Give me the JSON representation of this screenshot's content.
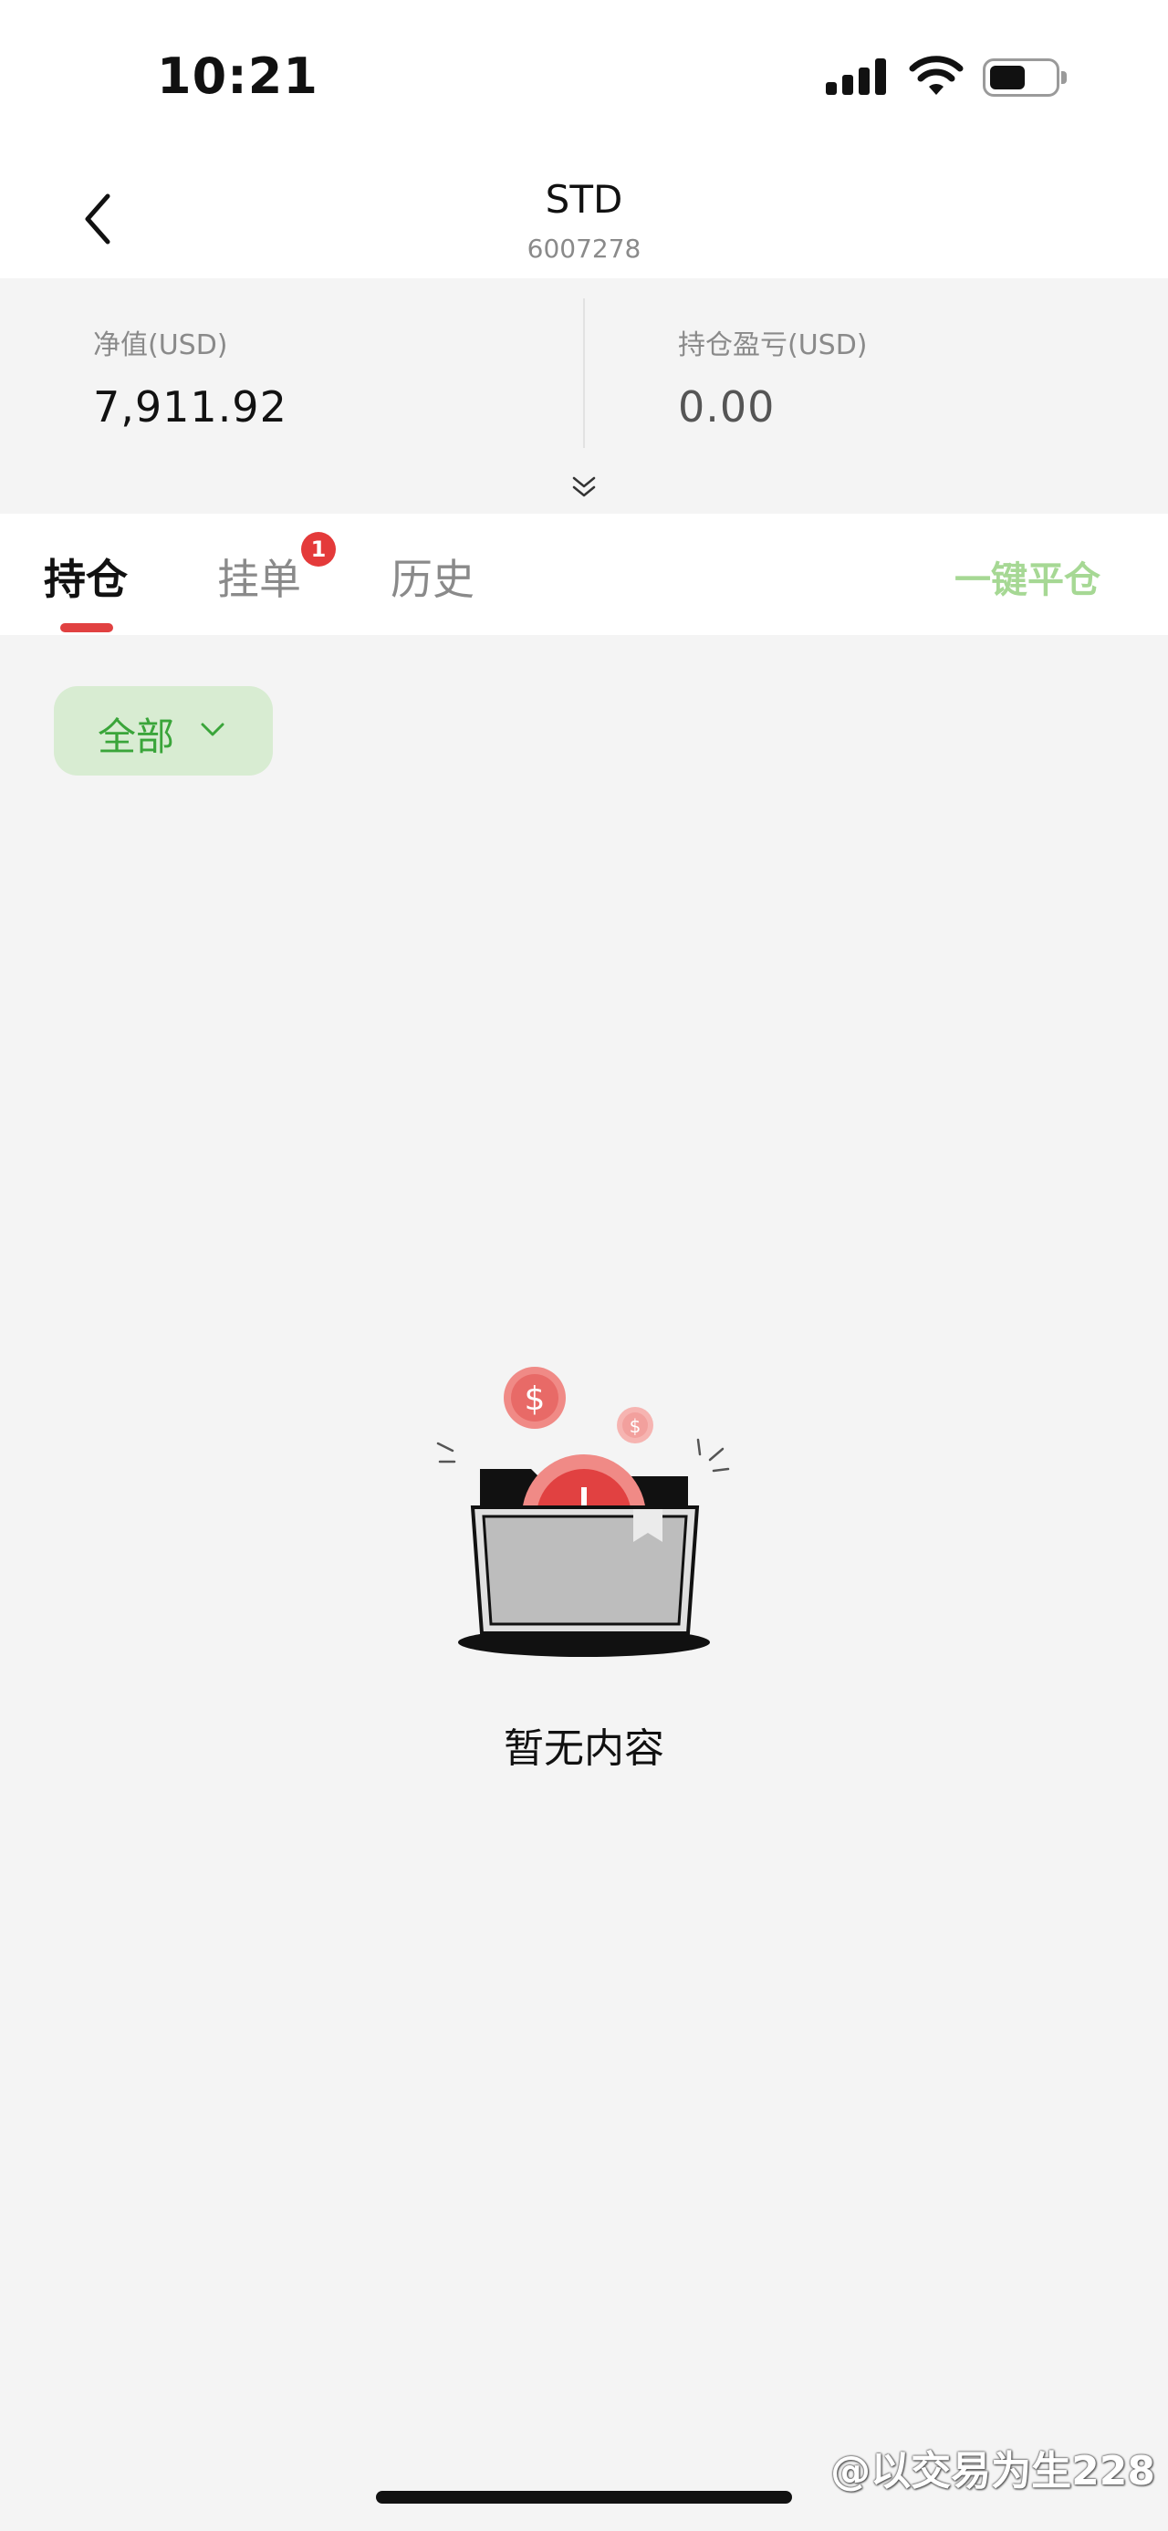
{
  "status_bar": {
    "time": "10:21",
    "icons": [
      "cellular-signal-icon",
      "wifi-icon",
      "battery-icon"
    ]
  },
  "header": {
    "back_icon": "chevron-left-icon",
    "title": "STD",
    "account_number": "6007278"
  },
  "summary": {
    "net_value_label": "净值(USD)",
    "net_value": "7,911.92",
    "position_pnl_label": "持仓盈亏(USD)",
    "position_pnl": "0.00",
    "expand_icon": "double-chevron-down-icon"
  },
  "tabs": {
    "items": [
      {
        "label": "持仓",
        "active": true
      },
      {
        "label": "挂单",
        "active": false,
        "badge": "1"
      },
      {
        "label": "历史",
        "active": false
      }
    ],
    "close_all_label": "一键平仓"
  },
  "filter": {
    "selected": "全部",
    "icon": "chevron-down-icon"
  },
  "empty_state": {
    "icon": "empty-folder-coins-icon",
    "text": "暂无内容"
  },
  "watermark": {
    "text": "@以交易为生228"
  },
  "colors": {
    "accent_red": "#e14141",
    "accent_green": "#3aa53a",
    "close_all_green": "#a6d894",
    "chip_bg": "#d8ecd2"
  }
}
